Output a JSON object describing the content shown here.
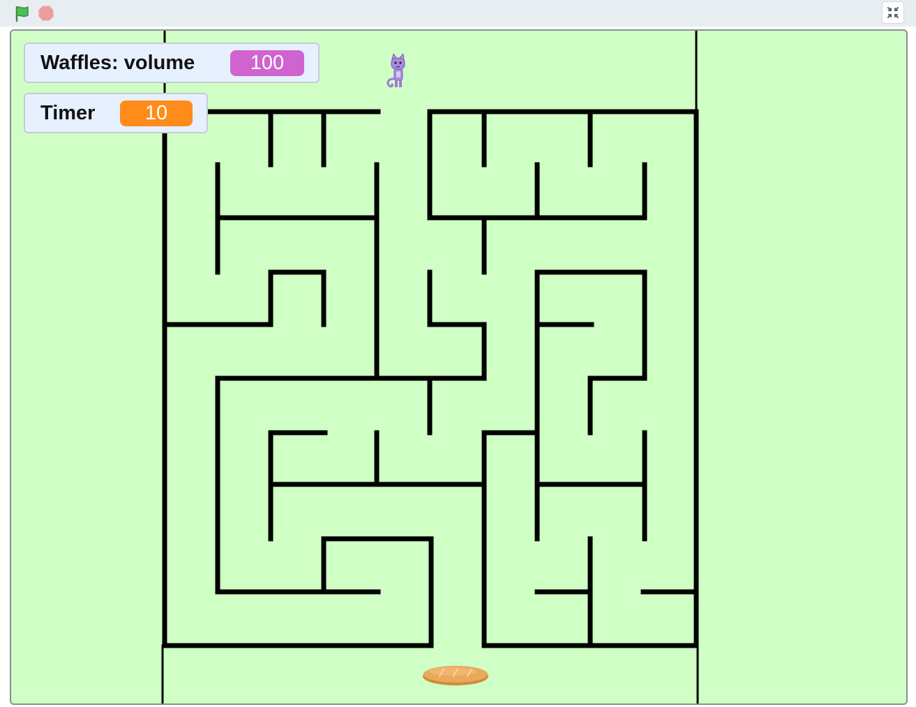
{
  "toolbar": {
    "green_flag_icon": "green-flag-icon",
    "stop_icon": "stop-sign-icon",
    "fullscreen_icon": "exit-fullscreen-icon"
  },
  "monitors": {
    "volume": {
      "label": "Waffles: volume",
      "value": "100",
      "color": "#cf63cf"
    },
    "timer": {
      "label": "Timer",
      "value": "10",
      "color": "#ff8c1a"
    }
  },
  "stage": {
    "background": "#cfffc4",
    "wall_color": "#000000",
    "sprites": [
      "cat-sprite",
      "bread-sprite"
    ]
  }
}
